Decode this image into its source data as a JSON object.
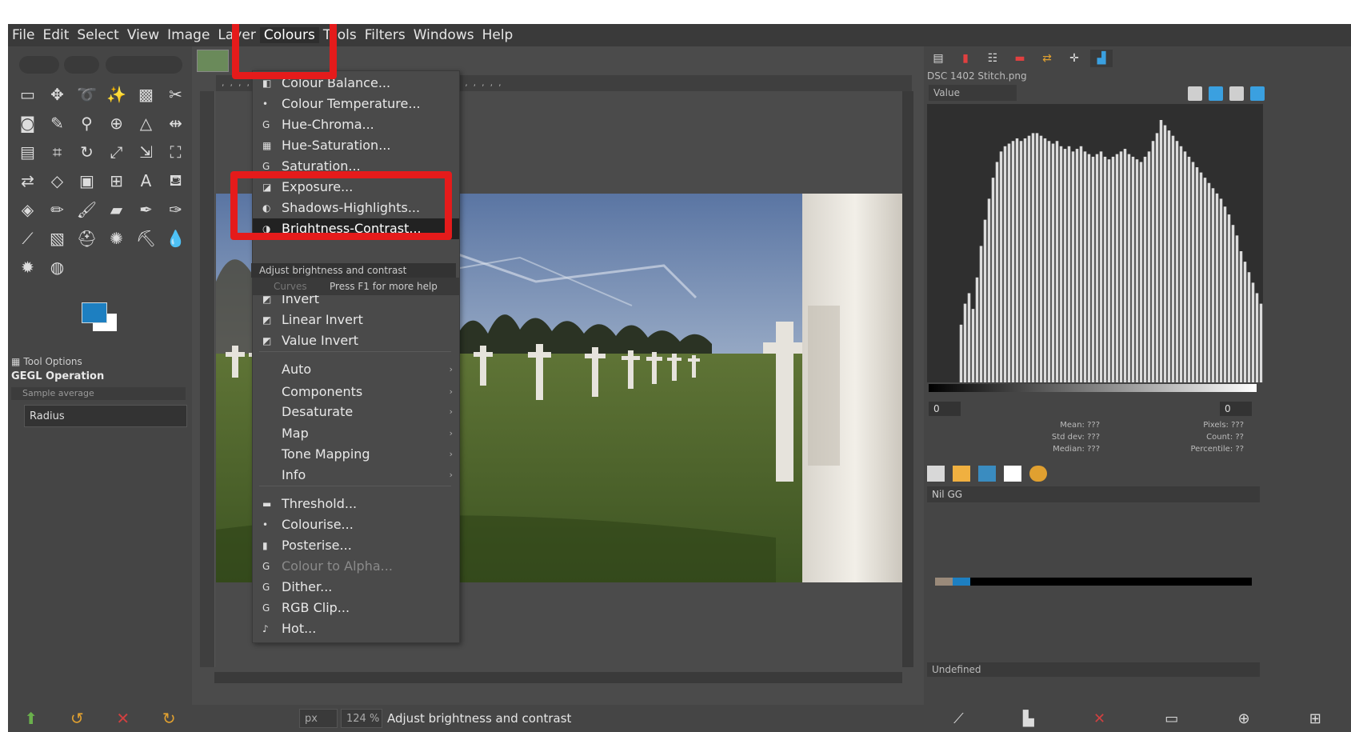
{
  "menubar": {
    "items": [
      "File",
      "Edit",
      "Select",
      "View",
      "Image",
      "Layer",
      "Colours",
      "Tools",
      "Filters",
      "Windows",
      "Help"
    ],
    "active": "Colours"
  },
  "toolbox": {
    "tool_options_tab": "Tool Options",
    "operation_title": "GEGL Operation",
    "sample_field": "Sample average",
    "radius_label": "Radius"
  },
  "colours_menu": {
    "items": [
      {
        "label": "Colour Balance...",
        "icon": "colour-balance-icon",
        "glyph": "◧",
        "state": "normal"
      },
      {
        "label": "Colour Temperature...",
        "icon": "colour-temperature-icon",
        "glyph": "•",
        "state": "normal"
      },
      {
        "label": "Hue-Chroma...",
        "icon": "gegl-icon",
        "glyph": "G",
        "state": "normal"
      },
      {
        "label": "Hue-Saturation...",
        "icon": "hue-saturation-icon",
        "glyph": "▦",
        "state": "normal"
      },
      {
        "label": "Saturation...",
        "icon": "gegl-icon",
        "glyph": "G",
        "state": "normal"
      },
      {
        "label": "Exposure...",
        "icon": "exposure-icon",
        "glyph": "◪",
        "state": "normal"
      },
      {
        "label": "Shadows-Highlights...",
        "icon": "shadows-highlights-icon",
        "glyph": "◐",
        "state": "normal"
      },
      {
        "label": "Brightness-Contrast...",
        "icon": "brightness-contrast-icon",
        "glyph": "◑",
        "state": "highlighted"
      },
      {
        "label": "Invert",
        "icon": "invert-icon",
        "glyph": "◩",
        "state": "normal"
      },
      {
        "label": "Linear Invert",
        "icon": "linear-invert-icon",
        "glyph": "◩",
        "state": "normal"
      },
      {
        "label": "Value Invert",
        "icon": "value-invert-icon",
        "glyph": "◩",
        "state": "normal"
      },
      {
        "label": "Auto",
        "icon": "",
        "glyph": "",
        "state": "submenu"
      },
      {
        "label": "Components",
        "icon": "",
        "glyph": "",
        "state": "submenu"
      },
      {
        "label": "Desaturate",
        "icon": "",
        "glyph": "",
        "state": "submenu"
      },
      {
        "label": "Map",
        "icon": "",
        "glyph": "",
        "state": "submenu"
      },
      {
        "label": "Tone Mapping",
        "icon": "",
        "glyph": "",
        "state": "submenu"
      },
      {
        "label": "Info",
        "icon": "",
        "glyph": "",
        "state": "submenu"
      },
      {
        "label": "Threshold...",
        "icon": "threshold-icon",
        "glyph": "▬",
        "state": "normal"
      },
      {
        "label": "Colourise...",
        "icon": "colourise-icon",
        "glyph": "•",
        "state": "normal"
      },
      {
        "label": "Posterise...",
        "icon": "posterise-icon",
        "glyph": "▮",
        "state": "normal"
      },
      {
        "label": "Colour to Alpha...",
        "icon": "gegl-icon",
        "glyph": "G",
        "state": "disabled"
      },
      {
        "label": "Dither...",
        "icon": "gegl-icon",
        "glyph": "G",
        "state": "normal"
      },
      {
        "label": "RGB Clip...",
        "icon": "gegl-icon",
        "glyph": "G",
        "state": "normal"
      },
      {
        "label": "Hot...",
        "icon": "hot-icon",
        "glyph": "♪",
        "state": "normal"
      }
    ],
    "tooltip": "Adjust brightness and contrast",
    "curves_hint": "Curves",
    "help_hint": "Press F1 for more help"
  },
  "canvas": {
    "ruler_text": "  ,  ,  ,  ,  ,  ,  ,  ,  ,  ,  ,  ,  ,  ,  ,  ,  ,  ,  ,  ,  ,  ,  ,  ,  ,  ,  ,  ,  ,  ,  ,  ,  ,  ,"
  },
  "statusbar": {
    "unit": "px",
    "zoom": "124 %",
    "message": "Adjust brightness and contrast"
  },
  "histogram": {
    "title": "DSC 1402 Stitch.png",
    "channel": "Value",
    "range_min": "0",
    "range_max": "0",
    "stats_left": [
      "Mean: ???",
      "Std dev: ???",
      "Median: ???"
    ],
    "stats_right": [
      "Pixels: ???",
      "Count: ??",
      "Percentile: ??"
    ],
    "bars": [
      0,
      0,
      0,
      0,
      0,
      0,
      0,
      0,
      22,
      30,
      34,
      28,
      40,
      52,
      62,
      70,
      78,
      84,
      88,
      90,
      91,
      92,
      93,
      92,
      93,
      94,
      95,
      95,
      94,
      93,
      92,
      91,
      92,
      90,
      89,
      90,
      88,
      89,
      90,
      88,
      87,
      86,
      87,
      88,
      86,
      85,
      86,
      87,
      88,
      89,
      87,
      86,
      85,
      84,
      86,
      88,
      92,
      95,
      100,
      98,
      96,
      94,
      92,
      90,
      88,
      86,
      84,
      82,
      80,
      78,
      76,
      74,
      72,
      70,
      67,
      64,
      60,
      56,
      50,
      46,
      42,
      38,
      34,
      30
    ]
  },
  "brushes": {
    "name": "Nil GG"
  },
  "dock_status": "Undefined",
  "colors": {
    "accent": "#1d7fc1",
    "highlight": "#e51b1b",
    "menu_bg": "#4a4a4a",
    "panel_bg": "#454545"
  }
}
